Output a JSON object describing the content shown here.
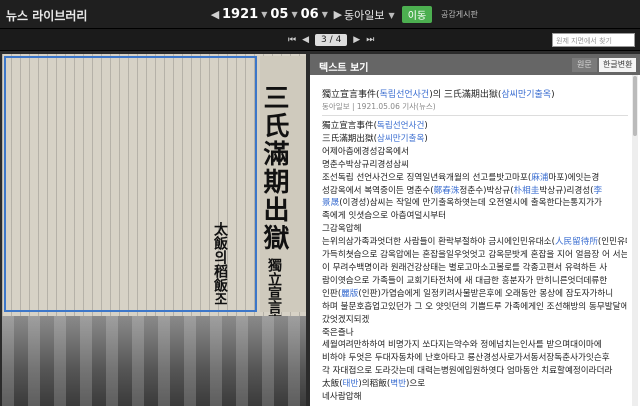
{
  "app": {
    "title": "뉴스 라이브러리"
  },
  "date": {
    "year": "1921",
    "month": "05",
    "day": "06",
    "sep1": "▼",
    "sep2": "▼"
  },
  "paper": {
    "name": "동아일보"
  },
  "go_label": "이동",
  "pub_link": "공감게시판",
  "pager": {
    "current": "3",
    "sep": "/",
    "total": "4"
  },
  "search": {
    "placeholder": "원제 지면에서 찾기"
  },
  "scan": {
    "headline": "三氏滿期出獄",
    "subhead": "獨立宣言事件",
    "subhead2": "太飯의稻飯조"
  },
  "panel": {
    "title": "텍스트 보기",
    "tab_original": "원문",
    "tab_converted": "한글변환",
    "article_title_a": "獨立宣言事件(",
    "article_title_b": "독립선언사건",
    "article_title_c": ")의 三氏滿期出獄(",
    "article_title_d": "삼씨만기출옥",
    "article_title_e": ")",
    "meta": "동아일보 | 1921.05.06 기사(뉴스)"
  },
  "article_lines": [
    [
      {
        "t": "獨立宣言事件("
      },
      {
        "t": "독립선언사건",
        "h": true
      },
      {
        "t": ")"
      }
    ],
    [
      {
        "t": "三氏滿期出獄("
      },
      {
        "t": "삼씨만기출옥",
        "h": true
      },
      {
        "t": ")"
      }
    ],
    [
      {
        "t": "어제아츰에경성감옥에서"
      }
    ],
    [
      {
        "t": "명춘수박상규리경성삼씨"
      }
    ],
    [
      {
        "t": "조선독립 선언사건으로 징역일년육개월의 선고를밧고마포("
      },
      {
        "t": "麻浦",
        "h": true
      },
      {
        "t": "마포"
      },
      {
        "t": ")에잇는경"
      }
    ],
    [
      {
        "t": "성감옥에서 복역중이든 명춘수("
      },
      {
        "t": "鄭春洙",
        "h": true
      },
      {
        "t": "정춘수"
      },
      {
        "t": ")박상규("
      },
      {
        "t": "朴相圭",
        "h": true
      },
      {
        "t": "박상규"
      },
      {
        "t": ")리경성("
      },
      {
        "t": "李",
        "h": true
      }
    ],
    [
      {
        "t": "景晟",
        "h": true
      },
      {
        "t": "(이경성)삼씨는 작일에 만기출옥하엿는데 오전열시에 출옥한다는통지가가"
      }
    ],
    [
      {
        "t": "족에게 잇셧슴으로 아츰여덜시부터"
      }
    ],
    [
      {
        "t": "그감옥압헤"
      }
    ],
    [
      {
        "t": "는위의삼가족과엇더한 사람들이 환락부절하야 금시에인민유대소("
      },
      {
        "t": "人民留待所",
        "h": true
      },
      {
        "t": "(인민유대소)는"
      }
    ],
    [
      {
        "t": "가득히쳣슴으로 감옥압에는 혼잡을일우엇엇고 감옥문밧게 혼잡을 지어 얼음장 어 서는사람"
      }
    ],
    [
      {
        "t": "이 무려수백명이라 원래건강상태는 별로고마소고볼로를 각종고편서 유력하든 사"
      }
    ],
    [
      {
        "t": "람이엿슴으로 가족들이 교회기타전처에 새 대급한 흥분자가 만히니른엇더데류한"
      }
    ],
    [
      {
        "t": "인판("
      },
      {
        "t": "麗版",
        "h": true
      },
      {
        "t": "(인판)"
      },
      {
        "t": "가엽슴에게 일정키려사물받은후에 오래동안 몽상에 잠도자가하니"
      }
    ],
    [
      {
        "t": "하며 불문호흡업고있던가 그 오 얏잇던의 기쁨드루 가족에게인 조선해방의 동무발달에 중"
      }
    ],
    [
      {
        "t": "갔엇겠지되겠"
      }
    ],
    [
      {
        "t": "죽은즐나"
      }
    ],
    [
      {
        "t": "세월여려만하하여 비명가지 쏘다지는약수와 정에넘치는인사를 받으며대이마에"
      }
    ],
    [
      {
        "t": "비하야 두엇은 두대자동차에 난호아타고 룡산경성사로가서동서장독춘사가잇슨후"
      }
    ],
    [
      {
        "t": "각 자대접으로 도라갓는데 대력는병원에입원하엿다 엄마동안 치료할예정이라더라"
      }
    ],
    [
      {
        "t": "太飯("
      },
      {
        "t": "태반",
        "h": true
      },
      {
        "t": ")의稻飯("
      },
      {
        "t": "벽반",
        "h": true
      },
      {
        "t": ")으로"
      }
    ],
    [
      {
        "t": "네사람압해"
      }
    ]
  ]
}
